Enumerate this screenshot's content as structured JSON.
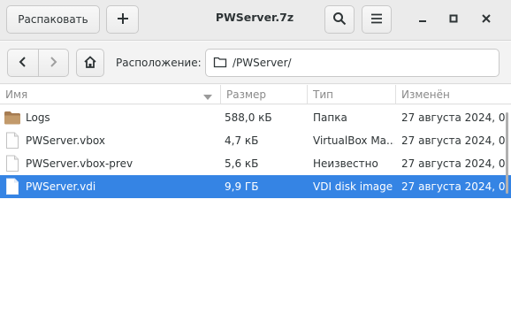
{
  "header": {
    "extract_label": "Распаковать",
    "title": "PWServer.7z"
  },
  "location": {
    "label": "Расположение:",
    "path": "/PWServer/"
  },
  "columns": {
    "name": "Имя",
    "size": "Размер",
    "type": "Тип",
    "modified": "Изменён"
  },
  "files": [
    {
      "name": "Logs",
      "size": "588,0 кБ",
      "type": "Папка",
      "modified": "27 августа 2024, 0...",
      "icon": "folder-icon"
    },
    {
      "name": "PWServer.vbox",
      "size": "4,7 кБ",
      "type": "VirtualBox Ma...",
      "modified": "27 августа 2024, 0...",
      "icon": "file-icon"
    },
    {
      "name": "PWServer.vbox-prev",
      "size": "5,6 кБ",
      "type": "Неизвестно",
      "modified": "27 августа 2024, 0...",
      "icon": "file-icon"
    },
    {
      "name": "PWServer.vdi",
      "size": "9,9 ГБ",
      "type": "VDI disk image",
      "modified": "27 августа 2024, 0...",
      "icon": "file-icon"
    }
  ],
  "selection": {
    "selected_file": "PWServer.vdi"
  },
  "colors": {
    "accent": "#3584e4",
    "folder": "#a67c52"
  }
}
